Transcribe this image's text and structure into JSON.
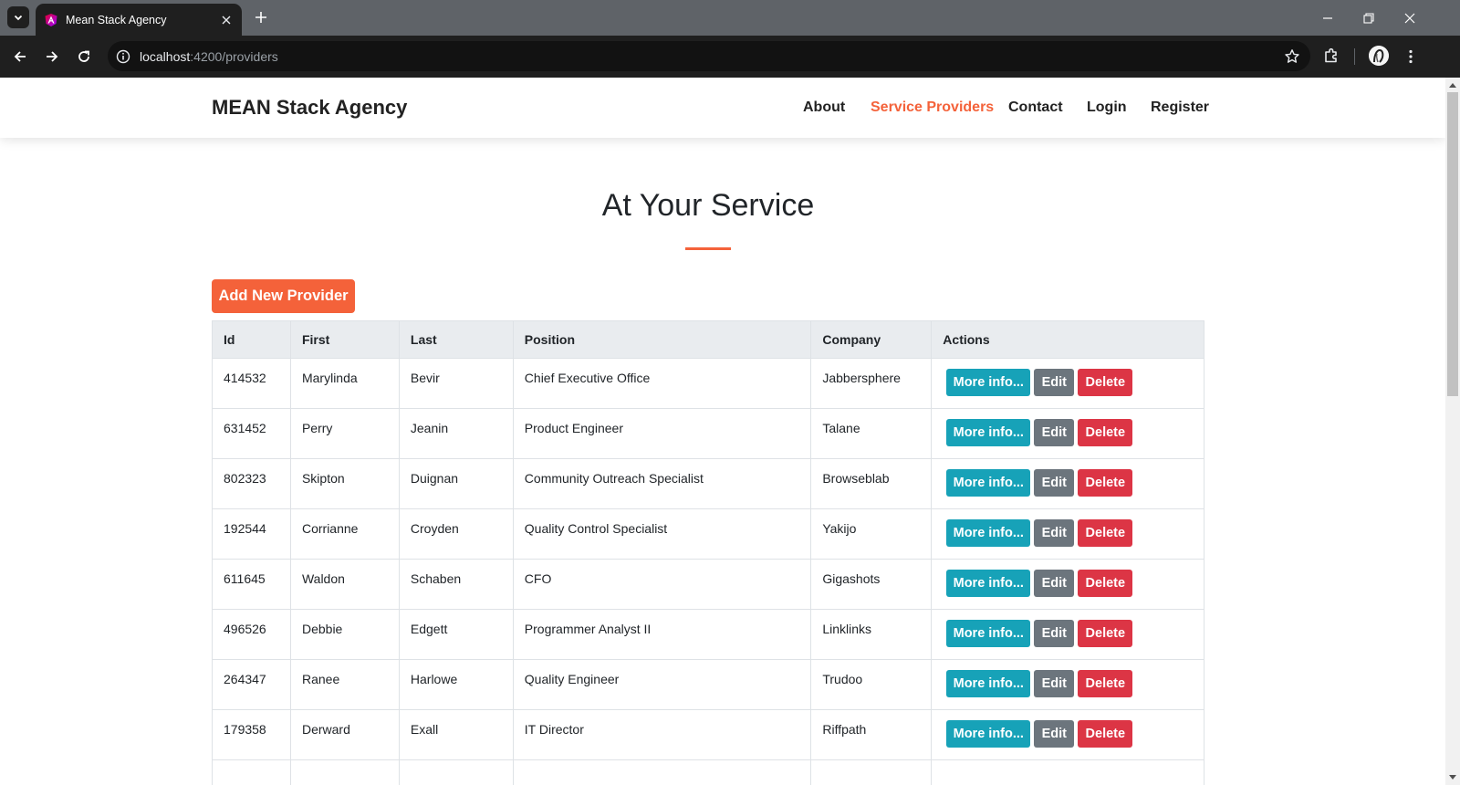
{
  "browser": {
    "tab_title": "Mean Stack Agency",
    "url_host": "localhost",
    "url_path": ":4200/providers"
  },
  "site": {
    "brand": "MEAN Stack Agency",
    "nav": [
      "About",
      "Service Providers",
      "Contact",
      "Login",
      "Register"
    ],
    "active_nav": "Service Providers"
  },
  "main": {
    "heading": "At Your Service",
    "add_button": "Add New Provider",
    "accent_color": "#f4623a"
  },
  "table": {
    "columns": [
      "Id",
      "First",
      "Last",
      "Position",
      "Company",
      "Actions"
    ],
    "action_labels": {
      "info": "More info...",
      "edit": "Edit",
      "delete": "Delete"
    },
    "rows": [
      {
        "id": "414532",
        "first": "Marylinda",
        "last": "Bevir",
        "position": "Chief Executive Office",
        "company": "Jabbersphere"
      },
      {
        "id": "631452",
        "first": "Perry",
        "last": "Jeanin",
        "position": "Product Engineer",
        "company": "Talane"
      },
      {
        "id": "802323",
        "first": "Skipton",
        "last": "Duignan",
        "position": "Community Outreach Specialist",
        "company": "Browseblab"
      },
      {
        "id": "192544",
        "first": "Corrianne",
        "last": "Croyden",
        "position": "Quality Control Specialist",
        "company": "Yakijo"
      },
      {
        "id": "611645",
        "first": "Waldon",
        "last": "Schaben",
        "position": "CFO",
        "company": "Gigashots"
      },
      {
        "id": "496526",
        "first": "Debbie",
        "last": "Edgett",
        "position": "Programmer Analyst II",
        "company": "Linklinks"
      },
      {
        "id": "264347",
        "first": "Ranee",
        "last": "Harlowe",
        "position": "Quality Engineer",
        "company": "Trudoo"
      },
      {
        "id": "179358",
        "first": "Derward",
        "last": "Exall",
        "position": "IT Director",
        "company": "Riffpath"
      },
      {
        "id": "",
        "first": "",
        "last": "",
        "position": "",
        "company": ""
      }
    ]
  }
}
